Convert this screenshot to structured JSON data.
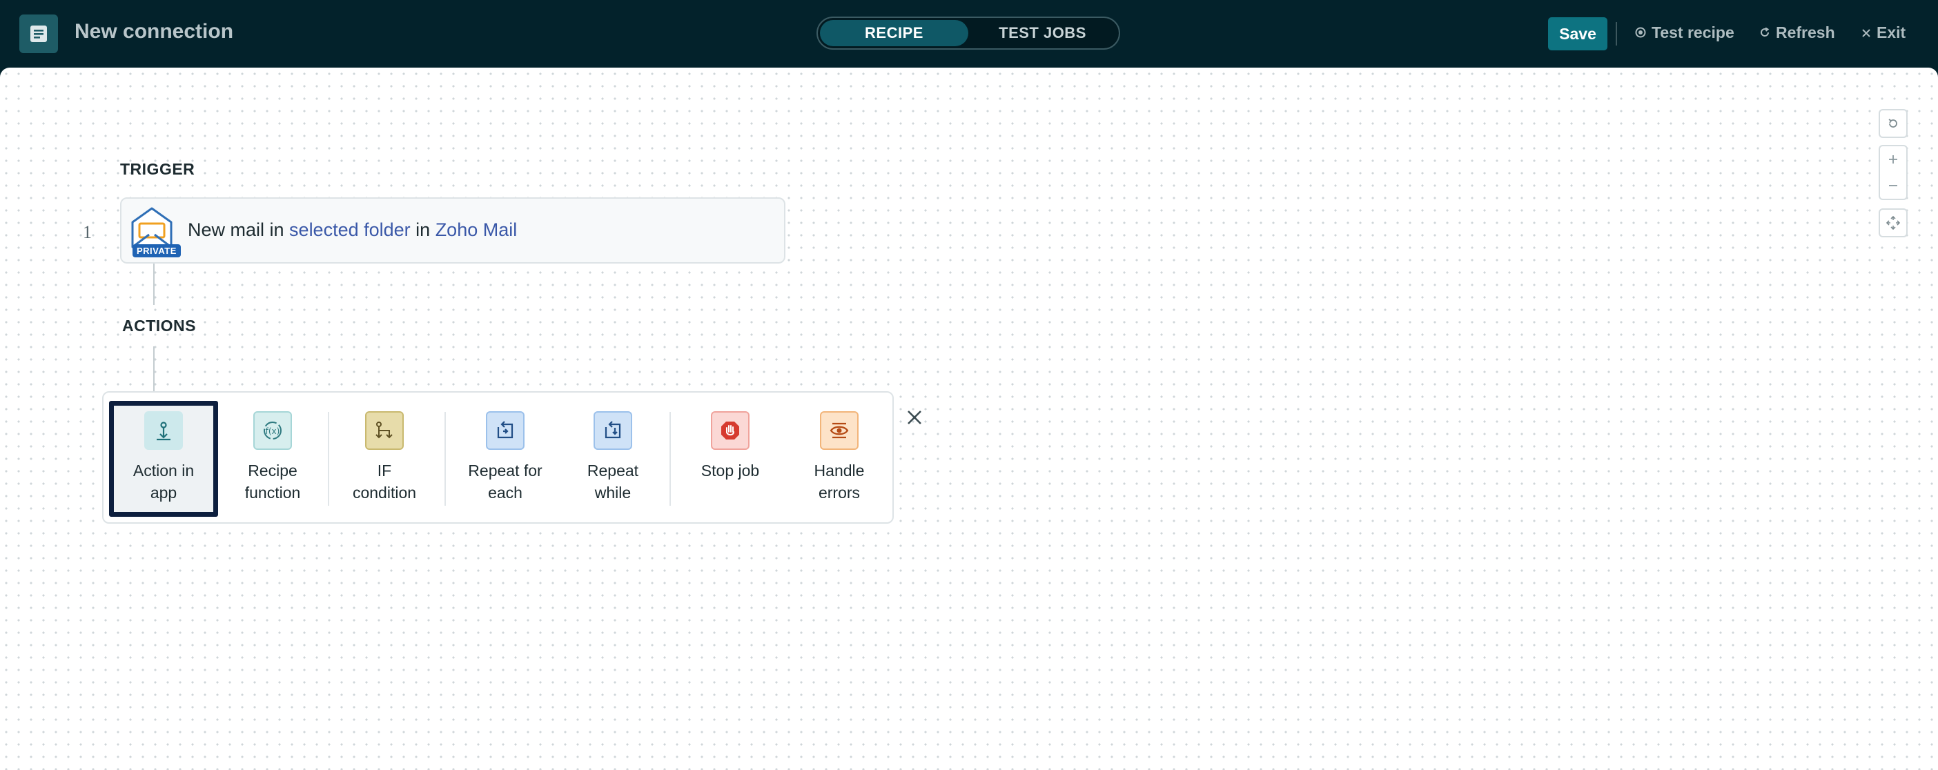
{
  "header": {
    "title": "New connection",
    "tabs": [
      {
        "label": "RECIPE",
        "active": true
      },
      {
        "label": "TEST JOBS",
        "active": false
      }
    ],
    "save_label": "Save",
    "test_recipe_label": "Test recipe",
    "refresh_label": "Refresh",
    "exit_label": "Exit"
  },
  "recipe": {
    "trigger_section": "TRIGGER",
    "actions_section": "ACTIONS",
    "trigger": {
      "step": "1",
      "badge": "PRIVATE",
      "text_pre": "New mail in ",
      "link1": "selected folder",
      "text_mid": " in ",
      "link2": "Zoho Mail"
    },
    "action_options": [
      {
        "label1": "Action in",
        "label2": "app",
        "icon": "action-in-app-icon",
        "color": "#cde9ec"
      },
      {
        "label1": "Recipe",
        "label2": "function",
        "icon": "recipe-function-icon",
        "color": "#d7eeee"
      },
      {
        "label1": "IF",
        "label2": "condition",
        "icon": "if-condition-icon",
        "color": "#e7dcaa"
      },
      {
        "label1": "Repeat for",
        "label2": "each",
        "icon": "repeat-for-each-icon",
        "color": "#cfe2f7"
      },
      {
        "label1": "Repeat",
        "label2": "while",
        "icon": "repeat-while-icon",
        "color": "#cfe2f7"
      },
      {
        "label1": "Stop job",
        "label2": "",
        "icon": "stop-job-icon",
        "color": "#fbd8d5"
      },
      {
        "label1": "Handle",
        "label2": "errors",
        "icon": "handle-errors-icon",
        "color": "#fde3c8"
      }
    ]
  },
  "colors": {
    "header_bg": "#03222b",
    "accent": "#0d7381",
    "link": "#3a58a8"
  }
}
